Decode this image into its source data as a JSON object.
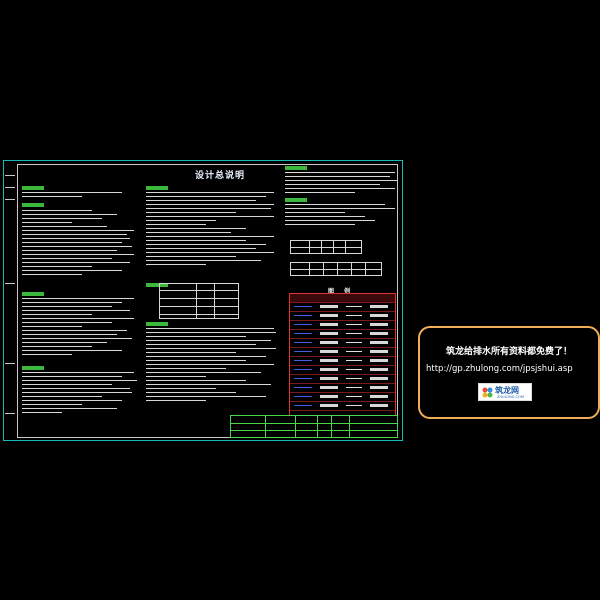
{
  "drawing": {
    "title": "设计总说明",
    "legend_title": "图 例"
  },
  "notice": {
    "title": "筑龙给排水所有资料都免费了！",
    "url": "http://gp.zhulong.com/jpsjshui.asp",
    "logo_text": "筑龙网",
    "logo_sub": "ZHULONG.COM"
  },
  "colors": {
    "background": "#000000",
    "frame": "#19b8b8",
    "notice_border": "#f2ad5b",
    "legend_border": "#e03030",
    "title_block": "#48d848"
  }
}
